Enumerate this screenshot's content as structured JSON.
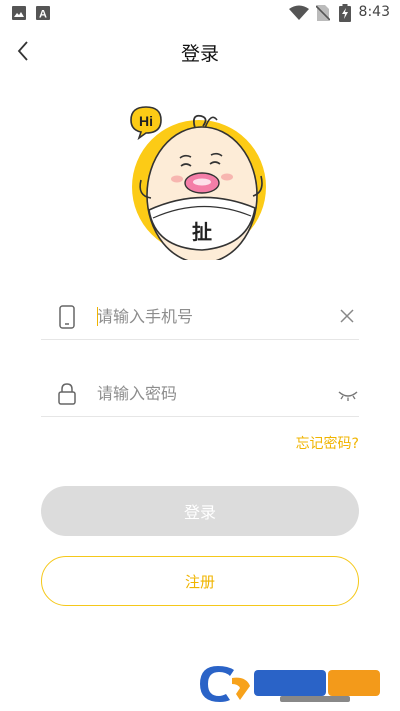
{
  "status_bar": {
    "time": "8:43",
    "icons": [
      "image-icon",
      "font-a-icon",
      "wifi-icon",
      "no-sim-icon",
      "battery-charging-icon"
    ]
  },
  "header": {
    "back_icon": "chevron-left-icon",
    "title": "登录"
  },
  "mascot": {
    "speech_text": "Hi",
    "diaper_text": "扯"
  },
  "form": {
    "phone": {
      "placeholder": "请输入手机号",
      "icon": "phone-icon",
      "action_icon": "clear-icon"
    },
    "password": {
      "placeholder": "请输入密码",
      "icon": "lock-icon",
      "action_icon": "eye-closed-icon"
    }
  },
  "forgot_password": "忘记密码?",
  "buttons": {
    "login": "登录",
    "register": "注册"
  },
  "colors": {
    "accent": "#f0b400",
    "disabled_button": "#dcdcdc"
  }
}
